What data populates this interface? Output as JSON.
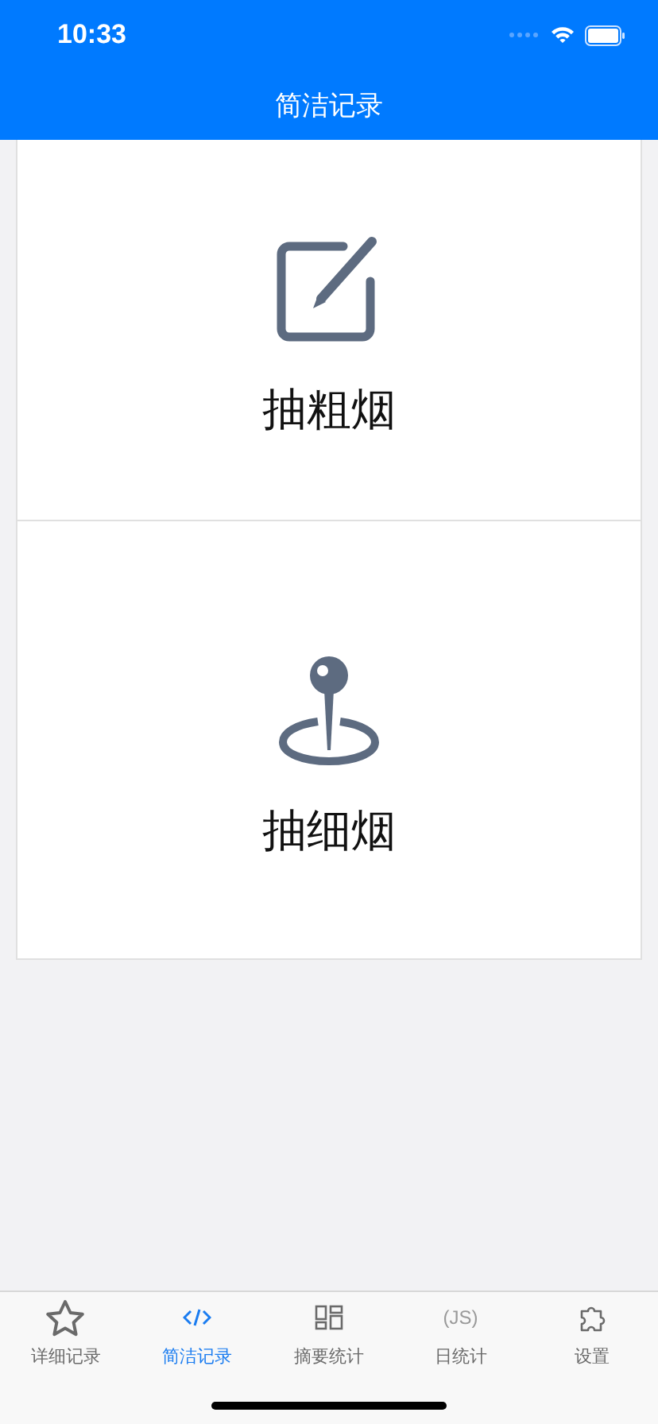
{
  "status_bar": {
    "time": "10:33"
  },
  "header": {
    "title": "简洁记录"
  },
  "actions": [
    {
      "kind": "edit",
      "label": "抽粗烟"
    },
    {
      "kind": "pin",
      "label": "抽细烟"
    }
  ],
  "tab_bar": [
    {
      "kind": "star",
      "label": "详细记录",
      "selected": false
    },
    {
      "kind": "code",
      "label": "简洁记录",
      "selected": true
    },
    {
      "kind": "grid",
      "label": "摘要统计",
      "selected": false
    },
    {
      "kind": "js",
      "icon_text": "(JS)",
      "label": "日统计",
      "selected": false
    },
    {
      "kind": "puzzle",
      "label": "设置",
      "selected": false
    }
  ]
}
